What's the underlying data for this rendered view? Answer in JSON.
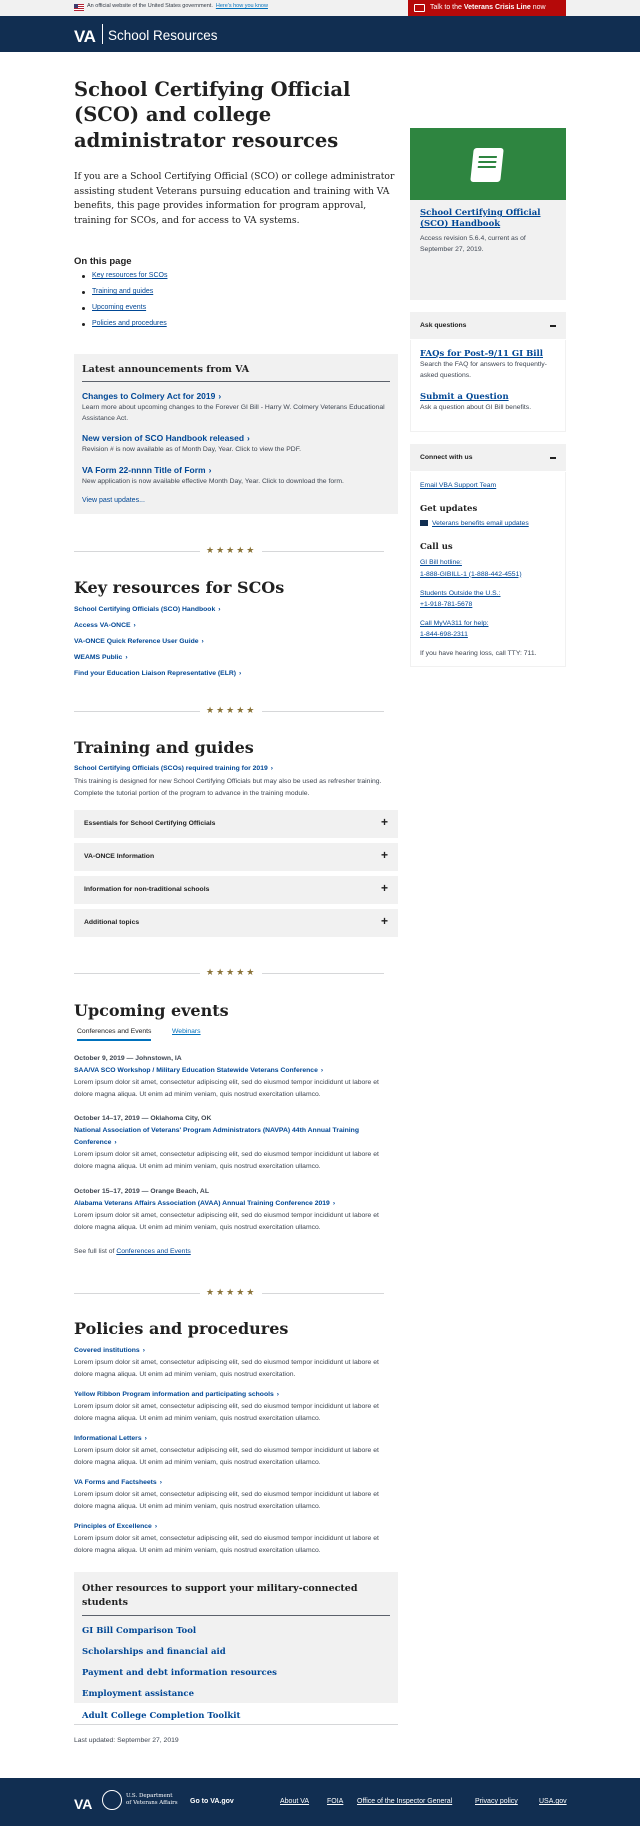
{
  "gov_banner": {
    "official_text": "An official website of the United States government.",
    "how_link": "Here's how you know",
    "crisis_prefix": "Talk to the ",
    "crisis_bold": "Veterans Crisis Line",
    "crisis_suffix": " now"
  },
  "header": {
    "logo": "VA",
    "site_title": "School Resources"
  },
  "page": {
    "title": "School Certifying Official (SCO) and college administrator resources",
    "intro": "If you are a School Certifying Official (SCO) or college administrator assisting student Veterans pursuing education and training with VA benefits, this page provides information for program approval, training for SCOs, and for access to VA systems."
  },
  "on_this_page": {
    "title": "On this page",
    "links": [
      "Key resources for SCOs",
      "Training and guides",
      "Upcoming events",
      "Policies and procedures"
    ]
  },
  "announcements": {
    "title": "Latest announcements from VA",
    "items": [
      {
        "title": "Changes to Colmery Act for 2019",
        "desc": "Learn more about upcoming changes to the Forever GI Bill - Harry W. Colmery Veterans Educational Assistance Act."
      },
      {
        "title": "New version of SCO Handbook released",
        "desc": "Revision # is now available as of Month Day, Year. Click to view the PDF."
      },
      {
        "title": "VA Form 22-nnnn Title of Form",
        "desc": "New application is now available effective Month Day, Year. Click to download the form."
      }
    ],
    "past_link": "View past updates..."
  },
  "divider_stars": "★★★★★",
  "key_resources": {
    "title": "Key resources for SCOs",
    "links": [
      "School Certifying Officials (SCO) Handbook",
      "Access VA-ONCE",
      "VA-ONCE Quick Reference User Guide",
      "WEAMS Public",
      "Find your Education Liaison Representative (ELR)"
    ]
  },
  "training": {
    "title": "Training and guides",
    "link": "School Certifying Officials (SCOs) required training for 2019",
    "desc": "This training is designed for new School Certifying Officials but may also be used as refresher training. Complete the tutorial portion of the program to advance in the training module.",
    "accordions": [
      "Essentials for School Certifying Officials",
      "VA-ONCE Information",
      "Information for non-traditional schools",
      "Additional topics"
    ]
  },
  "events": {
    "title": "Upcoming events",
    "tabs": [
      "Conferences and Events",
      "Webinars"
    ],
    "items": [
      {
        "meta": "October 9, 2019 — Johnstown, IA",
        "name": "SAA/VA SCO Workshop / Military Education Statewide Veterans Conference",
        "desc": "Lorem ipsum dolor sit amet, consectetur adipiscing elit, sed do eiusmod tempor incididunt ut labore et dolore magna aliqua. Ut enim ad minim veniam, quis nostrud exercitation ullamco."
      },
      {
        "meta": "October 14–17, 2019 — Oklahoma City, OK",
        "name": "National Association of Veterans' Program Administrators (NAVPA) 44th Annual Training Conference",
        "desc": "Lorem ipsum dolor sit amet, consectetur adipiscing elit, sed do eiusmod tempor incididunt ut labore et dolore magna aliqua. Ut enim ad minim veniam, quis nostrud exercitation ullamco."
      },
      {
        "meta": "October 15–17, 2019 — Orange Beach, AL",
        "name": "Alabama Veterans Affairs Association (AVAA) Annual Training Conference 2019",
        "desc": "Lorem ipsum dolor sit amet, consectetur adipiscing elit, sed do eiusmod tempor incididunt ut labore et dolore magna aliqua. Ut enim ad minim veniam, quis nostrud exercitation ullamco."
      }
    ],
    "see_full_prefix": "See full list of ",
    "see_full_link": "Conferences and Events"
  },
  "policies": {
    "title": "Policies and procedures",
    "items": [
      {
        "name": "Covered institutions",
        "desc": "Lorem ipsum dolor sit amet, consectetur adipiscing elit, sed do eiusmod tempor incididunt ut labore et dolore magna aliqua. Ut enim ad minim veniam, quis nostrud exercitation."
      },
      {
        "name": "Yellow Ribbon Program information and participating schools",
        "desc": "Lorem ipsum dolor sit amet, consectetur adipiscing elit, sed do eiusmod tempor incididunt ut labore et dolore magna aliqua. Ut enim ad minim veniam, quis nostrud exercitation ullamco."
      },
      {
        "name": "Informational Letters",
        "desc": "Lorem ipsum dolor sit amet, consectetur adipiscing elit, sed do eiusmod tempor incididunt ut labore et dolore magna aliqua. Ut enim ad minim veniam, quis nostrud exercitation ullamco."
      },
      {
        "name": "VA Forms and Factsheets",
        "desc": "Lorem ipsum dolor sit amet, consectetur adipiscing elit, sed do eiusmod tempor incididunt ut labore et dolore magna aliqua. Ut enim ad minim veniam, quis nostrud exercitation ullamco."
      },
      {
        "name": "Principles of Excellence",
        "desc": "Lorem ipsum dolor sit amet, consectetur adipiscing elit, sed do eiusmod tempor incididunt ut labore et dolore magna aliqua. Ut enim ad minim veniam, quis nostrud exercitation ullamco."
      }
    ]
  },
  "other_resources": {
    "title": "Other resources to support your military-connected students",
    "links": [
      "GI Bill Comparison Tool",
      "Scholarships and financial aid",
      "Payment and debt information resources",
      "Employment assistance",
      "Adult College Completion Toolkit"
    ]
  },
  "last_updated": "Last updated: September 27, 2019",
  "sidebar": {
    "handbook": {
      "title": "School Certifying Official (SCO) Handbook",
      "desc": "Access revision 5.6.4, current as of September 27, 2019."
    },
    "ask": {
      "title": "Ask questions",
      "items": [
        {
          "link": "FAQs for Post-9/11 GI Bill",
          "desc": "Search the FAQ for answers to frequently-asked questions."
        },
        {
          "link": "Submit a Question",
          "desc": "Ask a question about GI Bill benefits."
        }
      ]
    },
    "connect": {
      "title": "Connect with us",
      "email_link": "Email VBA Support Team",
      "updates_title": "Get updates",
      "updates_link": "Veterans benefits email updates",
      "call_title": "Call us",
      "calls": [
        {
          "label": "GI Bill hotline:",
          "number": "1-888-GIBILL-1 (1-888-442-4551)"
        },
        {
          "label": "Students Outside the U.S.:",
          "number": "+1-918-781-5678"
        },
        {
          "label": "Call MyVA311 for help:",
          "number": "1-844-698-2311"
        }
      ],
      "tty": "If you have hearing loss, call TTY: 711."
    }
  },
  "footer": {
    "logo": "VA",
    "dept_line1": "U.S. Department",
    "dept_line2": "of Veterans Affairs",
    "goto": "Go to VA.gov",
    "links": [
      "About VA",
      "FOIA",
      "Office of the Inspector General",
      "Privacy policy",
      "USA.gov"
    ]
  },
  "colors": {
    "navy": "#112e51",
    "link": "#004795",
    "crisis_red": "#b50909",
    "handbook_green": "#2e8540",
    "star_gold": "#8a7237"
  },
  "icons": [
    "flag-icon",
    "crisis-chat-icon",
    "book-icon",
    "chevron-right-icon",
    "plus-icon",
    "minus-icon",
    "envelope-icon",
    "va-seal-icon"
  ]
}
